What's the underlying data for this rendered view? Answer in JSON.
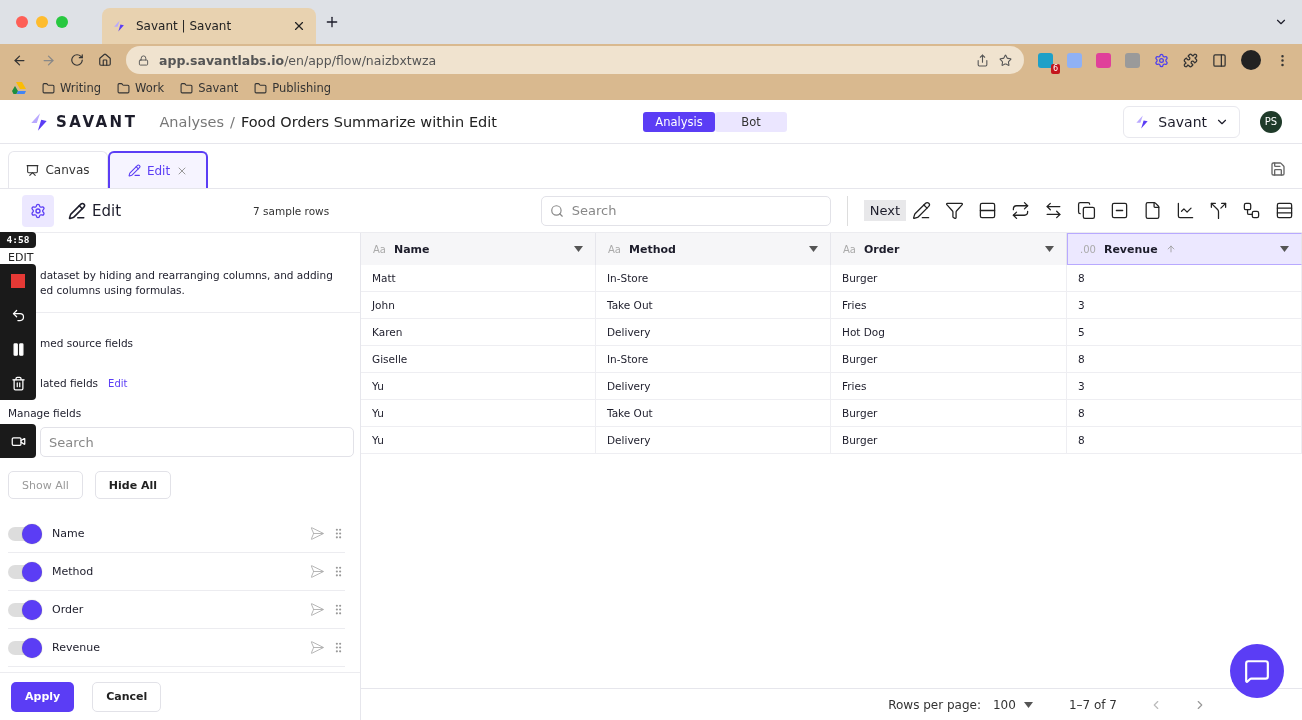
{
  "browser": {
    "tab_title": "Savant | Savant",
    "url": "**app.savantlabs.io**/en/app/flow/naizbxtwza",
    "bookmarks": [
      "Writing",
      "Work",
      "Savant",
      "Publishing"
    ],
    "extension_badge": "6"
  },
  "header": {
    "brand": "SAVANT",
    "breadcrumb": [
      "Analyses",
      "Food Orders Summarize within Edit"
    ],
    "breadcrumb_separator": "/",
    "modes": [
      {
        "label": "Analysis",
        "selected": true
      },
      {
        "label": "Bot",
        "selected": false
      }
    ],
    "workspace": "Savant",
    "avatar": "PS"
  },
  "tabs": [
    {
      "label": "Canvas",
      "selected": false,
      "closable": false
    },
    {
      "label": "Edit",
      "selected": true,
      "closable": true
    }
  ],
  "edit_toolbar": {
    "title": "Edit",
    "sample_rows": "7 sample rows",
    "search_placeholder": "Search",
    "next": "Next"
  },
  "side_panel": {
    "section_label": "EDIT",
    "description": [
      "dataset by hiding and rearranging columns, and adding",
      "ed columns using formulas."
    ],
    "source_fields": "med source fields",
    "calculated_fields": "lated fields",
    "calculated_edit": "Edit",
    "manage_fields": "Manage fields",
    "search_placeholder": "Search",
    "show_all": {
      "label": "Show All",
      "disabled": true
    },
    "hide_all": {
      "label": "Hide All",
      "disabled": false
    },
    "fields": [
      {
        "name": "Name",
        "visible": true
      },
      {
        "name": "Method",
        "visible": true
      },
      {
        "name": "Order",
        "visible": true
      },
      {
        "name": "Revenue",
        "visible": true
      }
    ],
    "apply": "Apply",
    "cancel": "Cancel"
  },
  "recorder": {
    "timer": "4:58"
  },
  "table": {
    "columns": [
      {
        "type_label": "Aa",
        "name": "Name",
        "selected": false,
        "sorted": false
      },
      {
        "type_label": "Aa",
        "name": "Method",
        "selected": false,
        "sorted": false
      },
      {
        "type_label": "Aa",
        "name": "Order",
        "selected": false,
        "sorted": false
      },
      {
        "type_label": ".00",
        "name": "Revenue",
        "selected": true,
        "sorted": true
      }
    ],
    "rows": [
      [
        "Matt",
        "In-Store",
        "Burger",
        "8"
      ],
      [
        "John",
        "Take Out",
        "Fries",
        "3"
      ],
      [
        "Karen",
        "Delivery",
        "Hot Dog",
        "5"
      ],
      [
        "Giselle",
        "In-Store",
        "Burger",
        "8"
      ],
      [
        "Yu",
        "Delivery",
        "Fries",
        "3"
      ],
      [
        "Yu",
        "Take Out",
        "Burger",
        "8"
      ],
      [
        "Yu",
        "Delivery",
        "Burger",
        "8"
      ]
    ]
  },
  "footer": {
    "rows_per_page_label": "Rows per page:",
    "rows_per_page": "100",
    "range": "1–7 of 7"
  }
}
